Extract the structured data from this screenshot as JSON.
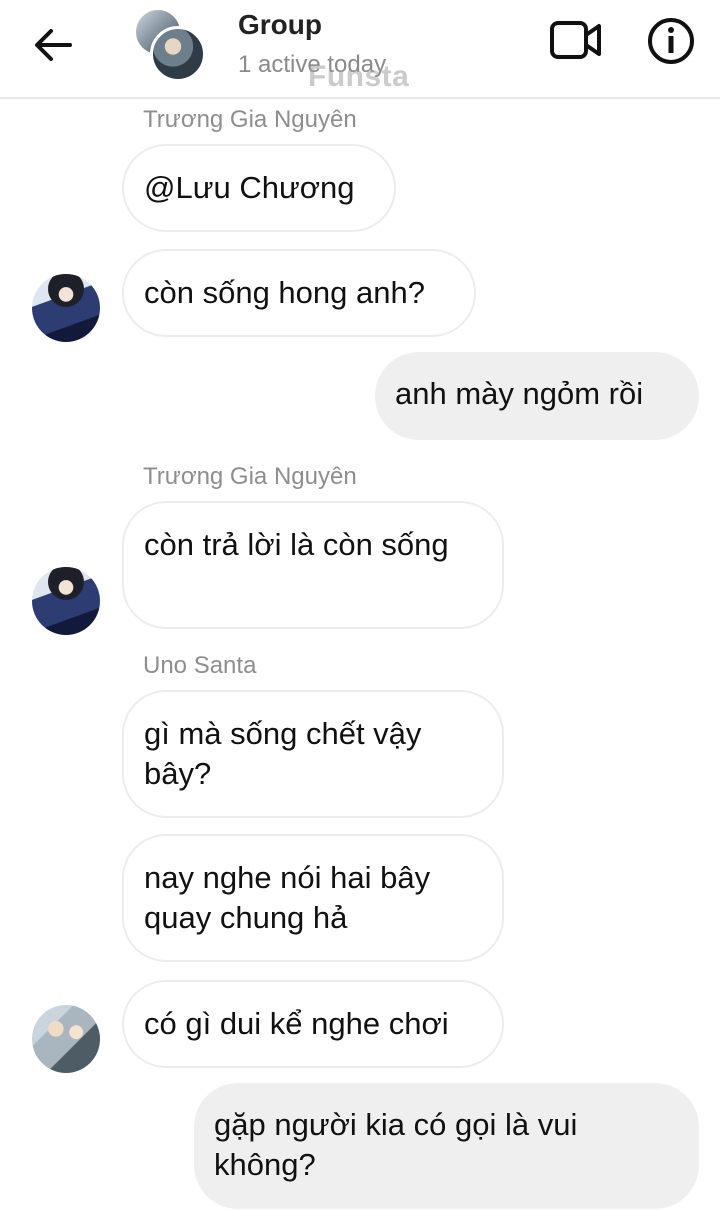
{
  "header": {
    "title": "Group",
    "subtitle": "1 active today",
    "watermark": "Funsta"
  },
  "icons": {
    "back": "arrow-left-icon",
    "video": "video-camera-icon",
    "info": "info-icon"
  },
  "messages": [
    {
      "sender": "Trương Gia Nguyên",
      "text": "@Lưu Chương",
      "direction": "incoming"
    },
    {
      "text": "còn sống hong anh?",
      "direction": "incoming"
    },
    {
      "text": "anh mày ngỏm rồi",
      "direction": "outgoing"
    },
    {
      "sender": "Trương Gia Nguyên",
      "text": "còn trả lời là còn sống",
      "direction": "incoming"
    },
    {
      "sender": "Uno Santa",
      "text": "gì mà sống chết vậy bây?",
      "direction": "incoming"
    },
    {
      "text": "nay nghe nói hai bây quay chung hả",
      "direction": "incoming"
    },
    {
      "text": "có gì dui kể nghe chơi",
      "direction": "incoming"
    },
    {
      "text": "gặp người kia có gọi là vui không?",
      "direction": "outgoing"
    }
  ],
  "colors": {
    "outgoing_bubble": "#efefef",
    "incoming_border": "#ececec",
    "sender_name": "#8e8e8e"
  }
}
